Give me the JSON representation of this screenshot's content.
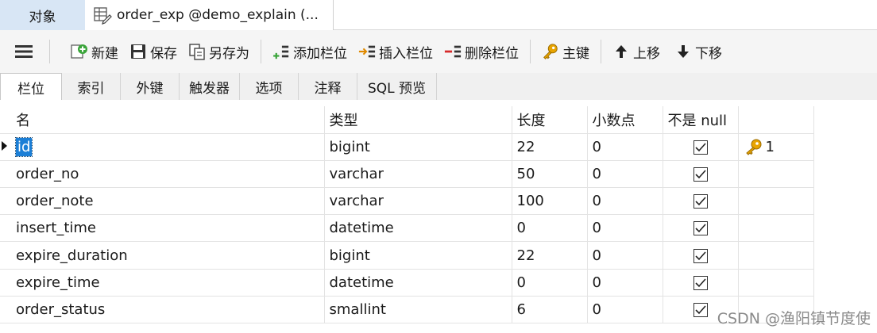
{
  "window_tabs": {
    "objects_label": "对象",
    "active_title": "order_exp @demo_explain (..."
  },
  "toolbar": {
    "new_label": "新建",
    "save_label": "保存",
    "save_as_label": "另存为",
    "add_field_label": "添加栏位",
    "insert_field_label": "插入栏位",
    "delete_field_label": "删除栏位",
    "primary_key_label": "主键",
    "move_up_label": "上移",
    "move_down_label": "下移"
  },
  "sub_tabs": [
    {
      "label": "栏位"
    },
    {
      "label": "索引"
    },
    {
      "label": "外键"
    },
    {
      "label": "触发器"
    },
    {
      "label": "选项"
    },
    {
      "label": "注释"
    },
    {
      "label": "SQL 预览"
    }
  ],
  "grid": {
    "columns": [
      "名",
      "类型",
      "长度",
      "小数点",
      "不是 null"
    ],
    "rows": [
      {
        "name": "id",
        "type": "bigint",
        "length": "22",
        "decimals": "0",
        "not_null": true,
        "key": "1"
      },
      {
        "name": "order_no",
        "type": "varchar",
        "length": "50",
        "decimals": "0",
        "not_null": true,
        "key": ""
      },
      {
        "name": "order_note",
        "type": "varchar",
        "length": "100",
        "decimals": "0",
        "not_null": true,
        "key": ""
      },
      {
        "name": "insert_time",
        "type": "datetime",
        "length": "0",
        "decimals": "0",
        "not_null": true,
        "key": ""
      },
      {
        "name": "expire_duration",
        "type": "bigint",
        "length": "22",
        "decimals": "0",
        "not_null": true,
        "key": ""
      },
      {
        "name": "expire_time",
        "type": "datetime",
        "length": "0",
        "decimals": "0",
        "not_null": true,
        "key": ""
      },
      {
        "name": "order_status",
        "type": "smallint",
        "length": "6",
        "decimals": "0",
        "not_null": true,
        "key": ""
      }
    ]
  },
  "watermark": "CSDN @渔阳镇节度使",
  "colors": {
    "selection": "#1c7fd6",
    "tab_highlight": "#d8e6f5",
    "toolbar_bg": "#f5f5f5"
  }
}
